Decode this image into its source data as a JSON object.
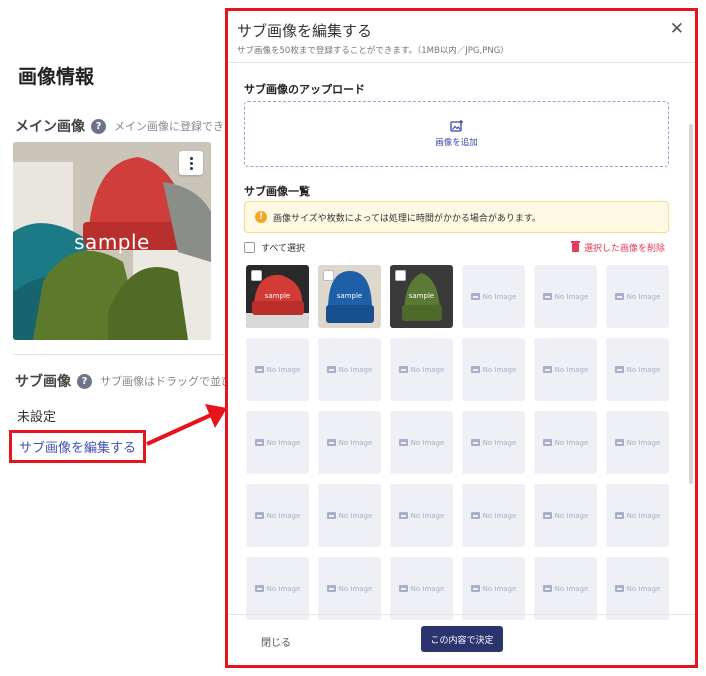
{
  "background": {
    "page_title": "画像情報",
    "main_image": {
      "label": "メイン画像",
      "hint": "メイン画像に登録できる",
      "watermark": "sample"
    },
    "sub_image": {
      "label": "サブ画像",
      "hint": "サブ画像はドラッグで並び",
      "status": "未設定",
      "edit_link": "サブ画像を編集する"
    }
  },
  "modal": {
    "title": "サブ画像を編集する",
    "subtitle": "サブ画像を50枚まで登録することができます。（1MB以内／JPG,PNG）",
    "upload_section_title": "サブ画像のアップロード",
    "add_image_label": "画像を追加",
    "list_section_title": "サブ画像一覧",
    "notice": "画像サイズや枚数によっては処理に時間がかかる場合があります。",
    "select_all_label": "すべて選択",
    "delete_selected_label": "選択した画像を削除",
    "no_image_label": "No Image",
    "thumb_watermark": "sample",
    "close_label": "閉じる",
    "confirm_label": "この内容で決定"
  },
  "colors": {
    "highlight_red": "#e8141b",
    "link_blue": "#3f51b5",
    "primary_navy": "#2c3470",
    "delete_pink": "#e23a5b",
    "notice_bg": "#fff9e3"
  }
}
